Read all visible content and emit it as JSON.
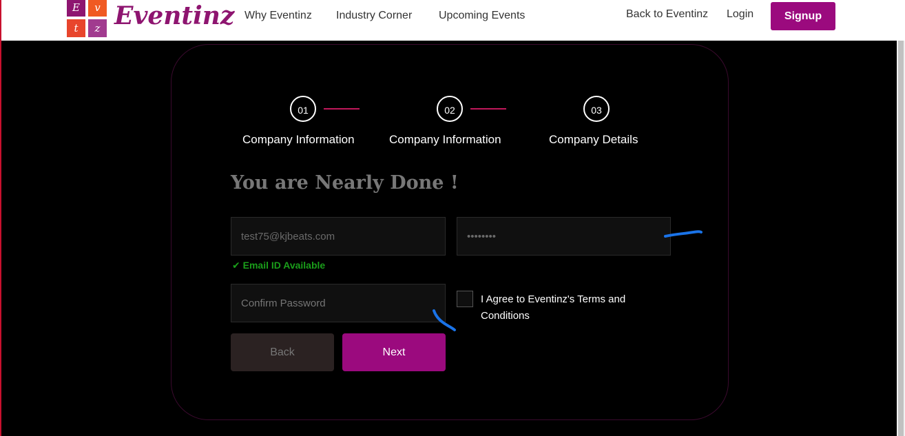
{
  "header": {
    "logo_text": "Eventinz",
    "logo_tiles": [
      "E",
      "v",
      "t",
      "z"
    ],
    "nav": [
      "Why Eventinz",
      "Industry Corner",
      "Upcoming Events"
    ],
    "back_link": "Back to Eventinz",
    "login": "Login",
    "signup": "Signup"
  },
  "steps": [
    {
      "number": "01",
      "label": "Company Information"
    },
    {
      "number": "02",
      "label": "Company Information"
    },
    {
      "number": "03",
      "label": "Company Details"
    }
  ],
  "form": {
    "title": "You are Nearly Done !",
    "email_value": "test75@kjbeats.com",
    "password_value": "••••••••",
    "email_status": "Email ID Available",
    "confirm_placeholder": "Confirm Password",
    "agree_text": "I Agree to Eventinz's Terms and Conditions",
    "back_button": "Back",
    "next_button": "Next"
  },
  "colors": {
    "brand": "#9b0a7e",
    "step_line": "#c2185b",
    "success": "#1a9e1a",
    "annotation": "#1a73e8"
  }
}
